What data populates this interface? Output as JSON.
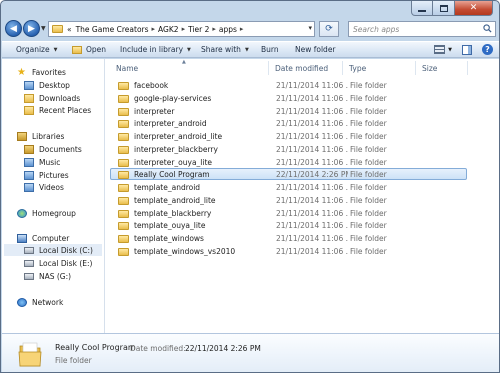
{
  "address": {
    "overflow": "«",
    "crumbs": [
      "The Game Creators",
      "AGK2",
      "Tier 2",
      "apps"
    ]
  },
  "search": {
    "placeholder": "Search apps"
  },
  "toolbar": {
    "organize": "Organize",
    "open": "Open",
    "include_in_library": "Include in library",
    "share_with": "Share with",
    "burn": "Burn",
    "new_folder": "New folder"
  },
  "nav": {
    "favorites": "Favorites",
    "desktop": "Desktop",
    "downloads": "Downloads",
    "recent_places": "Recent Places",
    "libraries": "Libraries",
    "documents": "Documents",
    "music": "Music",
    "pictures": "Pictures",
    "videos": "Videos",
    "homegroup": "Homegroup",
    "computer": "Computer",
    "local_disk_c": "Local Disk (C:)",
    "local_disk_e": "Local Disk (E:)",
    "nas_g": "NAS (G:)",
    "network": "Network"
  },
  "columns": {
    "name": "Name",
    "date_modified": "Date modified",
    "type": "Type",
    "size": "Size"
  },
  "files": [
    {
      "name": "facebook",
      "date": "21/11/2014 11:06 ...",
      "type": "File folder"
    },
    {
      "name": "google-play-services",
      "date": "21/11/2014 11:06 ...",
      "type": "File folder"
    },
    {
      "name": "interpreter",
      "date": "21/11/2014 11:06 ...",
      "type": "File folder"
    },
    {
      "name": "interpreter_android",
      "date": "21/11/2014 11:06 ...",
      "type": "File folder"
    },
    {
      "name": "interpreter_android_lite",
      "date": "21/11/2014 11:06 ...",
      "type": "File folder"
    },
    {
      "name": "interpreter_blackberry",
      "date": "21/11/2014 11:06 ...",
      "type": "File folder"
    },
    {
      "name": "interpreter_ouya_lite",
      "date": "21/11/2014 11:06 ...",
      "type": "File folder"
    },
    {
      "name": "Really Cool Program",
      "date": "22/11/2014 2:26 PM",
      "type": "File folder",
      "selected": true
    },
    {
      "name": "template_android",
      "date": "21/11/2014 11:06 ...",
      "type": "File folder"
    },
    {
      "name": "template_android_lite",
      "date": "21/11/2014 11:06 ...",
      "type": "File folder"
    },
    {
      "name": "template_blackberry",
      "date": "21/11/2014 11:06 ...",
      "type": "File folder"
    },
    {
      "name": "template_ouya_lite",
      "date": "21/11/2014 11:06 ...",
      "type": "File folder"
    },
    {
      "name": "template_windows",
      "date": "21/11/2014 11:06 ...",
      "type": "File folder"
    },
    {
      "name": "template_windows_vs2010",
      "date": "21/11/2014 11:06 ...",
      "type": "File folder"
    }
  ],
  "details": {
    "name": "Really Cool Program",
    "date_label": "Date modified:",
    "date_value": "22/11/2014 2:26 PM",
    "type": "File folder"
  }
}
